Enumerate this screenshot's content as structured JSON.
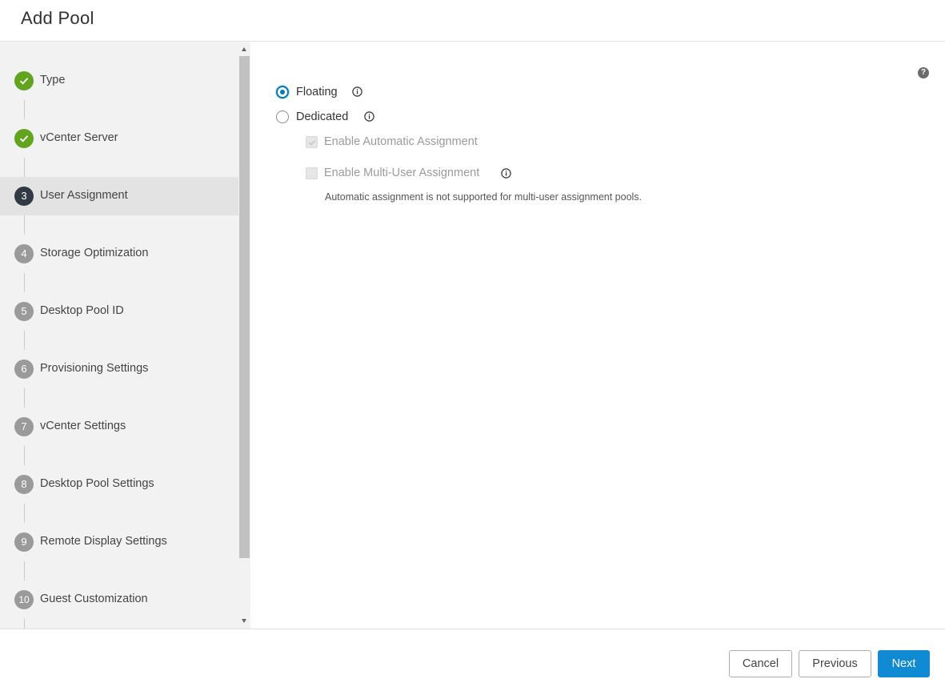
{
  "header": {
    "title": "Add Pool"
  },
  "steps": [
    {
      "number": "1",
      "label": "Type",
      "state": "done"
    },
    {
      "number": "2",
      "label": "vCenter Server",
      "state": "done"
    },
    {
      "number": "3",
      "label": "User Assignment",
      "state": "current"
    },
    {
      "number": "4",
      "label": "Storage Optimization",
      "state": "pending"
    },
    {
      "number": "5",
      "label": "Desktop Pool ID",
      "state": "pending"
    },
    {
      "number": "6",
      "label": "Provisioning Settings",
      "state": "pending"
    },
    {
      "number": "7",
      "label": "vCenter Settings",
      "state": "pending"
    },
    {
      "number": "8",
      "label": "Desktop Pool Settings",
      "state": "pending"
    },
    {
      "number": "9",
      "label": "Remote Display Settings",
      "state": "pending"
    },
    {
      "number": "10",
      "label": "Guest Customization",
      "state": "pending"
    }
  ],
  "assignment": {
    "floating": {
      "label": "Floating",
      "checked": true
    },
    "dedicated": {
      "label": "Dedicated",
      "checked": false
    },
    "auto_assign": {
      "label": "Enable Automatic Assignment",
      "checked": true,
      "disabled": true
    },
    "multi_user": {
      "label": "Enable Multi-User Assignment",
      "checked": false,
      "disabled": true
    },
    "hint": "Automatic assignment is not supported for multi-user assignment pools."
  },
  "help_icon": "question-circle-icon",
  "footer": {
    "cancel_label": "Cancel",
    "previous_label": "Previous",
    "next_label": "Next"
  },
  "colors": {
    "primary": "#0f8ad3",
    "step_done": "#62a420",
    "step_current": "#313a44",
    "step_pending": "#9a9a9a"
  }
}
